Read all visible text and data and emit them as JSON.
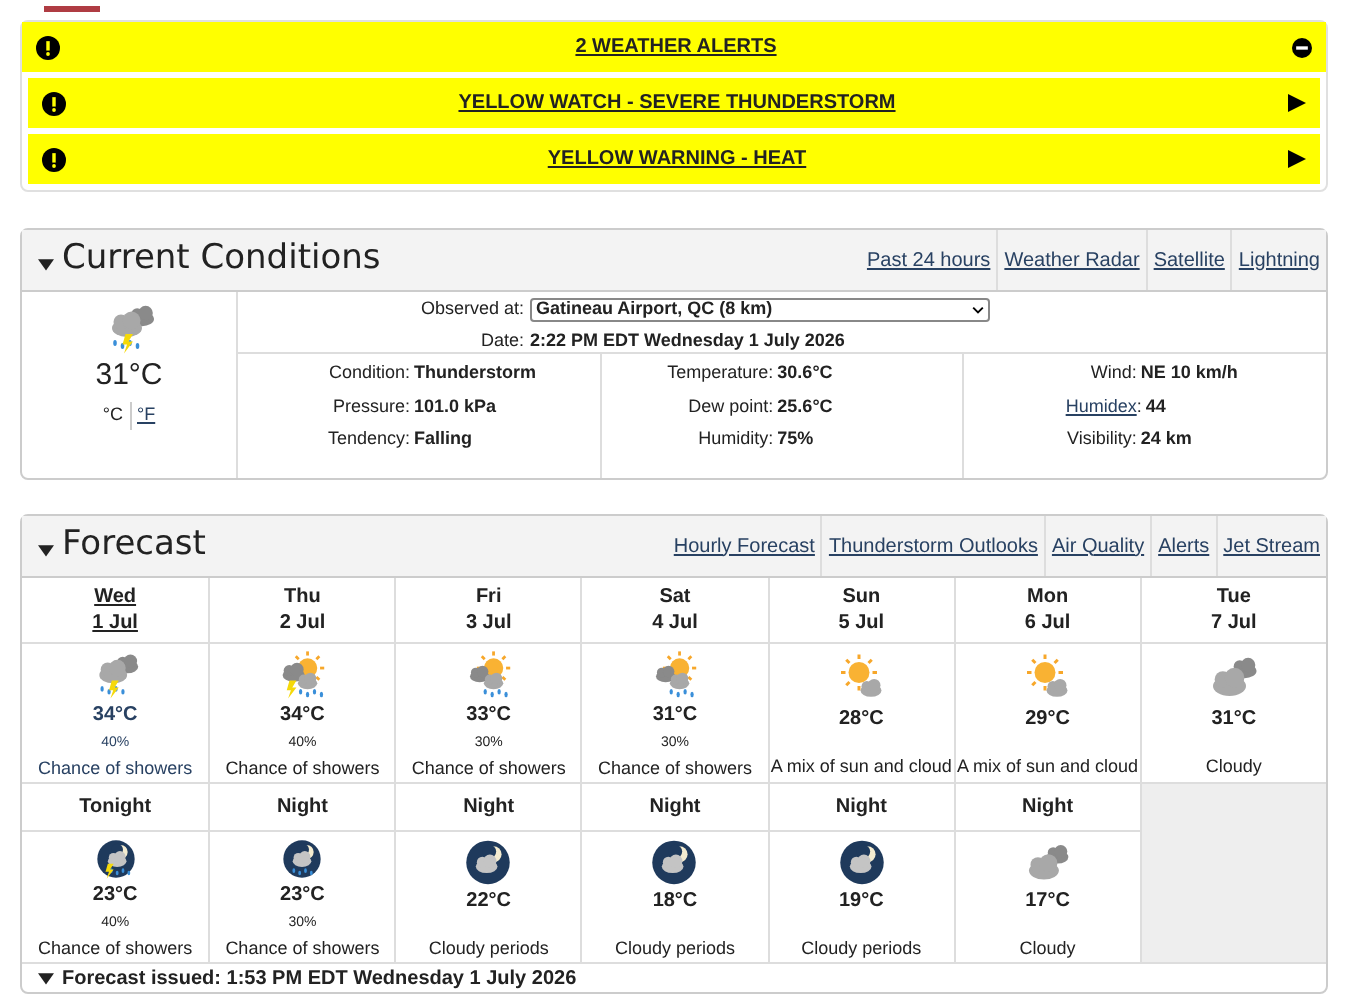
{
  "alerts": {
    "title": "2 WEATHER ALERTS",
    "expanded": true,
    "items": [
      {
        "title": "YELLOW WATCH - SEVERE THUNDERSTORM"
      },
      {
        "title": "YELLOW WARNING - HEAT"
      }
    ]
  },
  "current": {
    "title": "Current Conditions",
    "expanded": true,
    "links": [
      "Past 24 hours",
      "Weather Radar",
      "Satellite",
      "Lightning"
    ],
    "kind": "thunder-rain",
    "temperature": "31°C",
    "units": [
      {
        "label": "°C",
        "selected": true
      },
      {
        "label": "°F",
        "selected": false
      }
    ],
    "observed_label": "Observed at:",
    "station": "Gatineau Airport, QC (8 km)",
    "date_label": "Date:",
    "date": "2:22 PM EDT Wednesday 1 July 2026",
    "columns": [
      [
        {
          "label": "Condition:",
          "value": "Thunderstorm",
          "link": false
        },
        {
          "label": "Pressure:",
          "value": "101.0 kPa",
          "link": false
        },
        {
          "label": "Tendency:",
          "value": "Falling",
          "link": false
        }
      ],
      [
        {
          "label": "Temperature:",
          "value": "30.6°C",
          "link": false
        },
        {
          "label": "Dew point:",
          "value": "25.6°C",
          "link": false
        },
        {
          "label": "Humidity:",
          "value": "75%",
          "link": false
        }
      ],
      [
        {
          "label": "Wind:",
          "value": "NE 10 km/h",
          "link": false
        },
        {
          "label": "Humidex",
          "suffix": ":",
          "value": "44",
          "link": true
        },
        {
          "label": "Visibility:",
          "value": "24 km",
          "link": false
        }
      ]
    ]
  },
  "forecast": {
    "title": "Forecast",
    "expanded": true,
    "links": [
      "Hourly Forecast",
      "Thunderstorm Outlooks",
      "Air Quality",
      "Alerts",
      "Jet Stream"
    ],
    "days": [
      {
        "day": "Wed",
        "date": "1 Jul",
        "selected": true,
        "kind": "thunder-rain",
        "temp": "34°C",
        "pop": "40%",
        "summary": "Chance of showers"
      },
      {
        "day": "Thu",
        "date": "2 Jul",
        "selected": false,
        "kind": "sun-thunder-rain",
        "temp": "34°C",
        "pop": "40%",
        "summary": "Chance of showers"
      },
      {
        "day": "Fri",
        "date": "3 Jul",
        "selected": false,
        "kind": "sun-rain",
        "temp": "33°C",
        "pop": "30%",
        "summary": "Chance of showers"
      },
      {
        "day": "Sat",
        "date": "4 Jul",
        "selected": false,
        "kind": "sun-rain",
        "temp": "31°C",
        "pop": "30%",
        "summary": "Chance of showers"
      },
      {
        "day": "Sun",
        "date": "5 Jul",
        "selected": false,
        "kind": "sun-cloud",
        "temp": "28°C",
        "summary": "A mix of sun and cloud"
      },
      {
        "day": "Mon",
        "date": "6 Jul",
        "selected": false,
        "kind": "sun-cloud",
        "temp": "29°C",
        "summary": "A mix of sun and cloud"
      },
      {
        "day": "Tue",
        "date": "7 Jul",
        "selected": false,
        "kind": "cloudy",
        "temp": "31°C",
        "summary": "Cloudy"
      }
    ],
    "nights": [
      {
        "label": "Tonight",
        "kind": "night-thunder-rain",
        "temp": "23°C",
        "pop": "40%",
        "summary": "Chance of showers"
      },
      {
        "label": "Night",
        "kind": "night-rain",
        "temp": "23°C",
        "pop": "30%",
        "summary": "Chance of showers"
      },
      {
        "label": "Night",
        "kind": "night-cloud",
        "temp": "22°C",
        "summary": "Cloudy periods"
      },
      {
        "label": "Night",
        "kind": "night-cloud",
        "temp": "18°C",
        "summary": "Cloudy periods"
      },
      {
        "label": "Night",
        "kind": "night-cloud",
        "temp": "19°C",
        "summary": "Cloudy periods"
      },
      {
        "label": "Night",
        "kind": "cloudy",
        "temp": "17°C",
        "summary": "Cloudy"
      }
    ],
    "issued": "Forecast issued: 1:53 PM EDT Wednesday 1 July 2026"
  }
}
